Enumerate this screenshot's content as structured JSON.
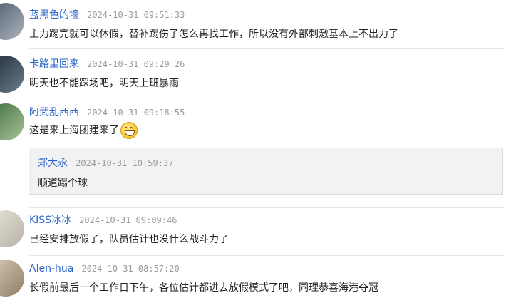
{
  "comments": [
    {
      "user": "蓝黑色的墙",
      "time": "2024-10-31 09:51:33",
      "text": "主力踢完就可以休假，替补踢伤了怎么再找工作，所以没有外部刺激基本上不出力了"
    },
    {
      "user": "卡路里回来",
      "time": "2024-10-31 09:29:26",
      "text": "明天也不能踩场吧，明天上班暴雨"
    },
    {
      "user": "阿武乱西西",
      "time": "2024-10-31 09:18:55",
      "text": "这是来上海团建来了",
      "emoji": "laughing-face-emoji",
      "reply": {
        "user": "郑大永",
        "time": "2024-10-31 10:59:37",
        "text": "顺道踢个球"
      }
    },
    {
      "user": "KISS冰冰",
      "time": "2024-10-31 09:09:46",
      "text": "已经安排放假了，队员估计也没什么战斗力了"
    },
    {
      "user": "Alen-hua",
      "time": "2024-10-31 08:57:20",
      "text": "长假前最后一个工作日下午，各位估计都进去放假模式了吧，同理恭喜海港夺冠"
    }
  ],
  "colors": {
    "username": "#2a66c9",
    "timestamp": "#9a9a9a",
    "text": "#222222",
    "reply_bg": "#f2f2f2"
  }
}
